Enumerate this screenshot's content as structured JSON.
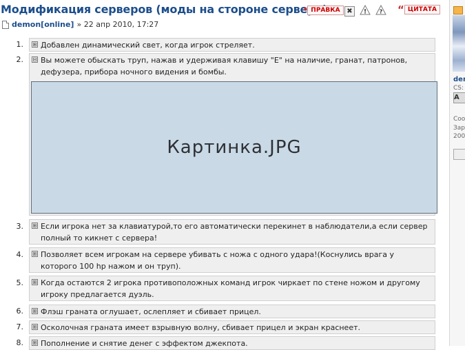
{
  "post": {
    "title": "Модификация серверов (моды на стороне сервера)",
    "edit_label": "ПРАВКА",
    "quote_label": "ЦИТАТА",
    "author": "demon[online]",
    "date": "» 22 апр 2010, 17:27",
    "delete_icon": "close-icon",
    "report_icon": "warning-icon",
    "help_icon": "question-icon"
  },
  "items": [
    {
      "num": "1.",
      "text": "Добавлен динамический свет, когда игрок стреляет.",
      "toggle": "⊞"
    },
    {
      "num": "2.",
      "text": "Вы можете обыскать труп, нажав и удерживая клавишу \"E\" на наличие, гранат, патронов, дефузера, прибора ночного видения и бомбы.",
      "toggle": "⊟",
      "image_label": "Картинка.JPG"
    },
    {
      "num": "3.",
      "text": "Если игрока нет за клавиатурой,то его автоматически перекинет в наблюдатели,а если сервер полный то кикнет с сервера!",
      "toggle": "⊞"
    },
    {
      "num": "4.",
      "text": "Позволяет всем игрокам на сервере убивать с ножа с одного удара!(Коснулись врага у которого 100 hp нажом и он труп).",
      "toggle": "⊞"
    },
    {
      "num": "5.",
      "text": "Когда остаются 2 игрока противоположных команд игрок чиркает по стене ножом и другому игроку предлагается дуэль.",
      "toggle": "⊞"
    },
    {
      "num": "6.",
      "text": "Флэш граната оглушает, ослепляет и сбивает прицел.",
      "toggle": "⊞"
    },
    {
      "num": "7.",
      "text": "Осколочная граната имеет взрывную волну, сбивает прицел и экран краснеет.",
      "toggle": "⊞"
    },
    {
      "num": "8.",
      "text": "Пополнение и снятие денег с эффектом джекпота.",
      "toggle": "⊞"
    }
  ],
  "sidebar": {
    "name": "der",
    "line1": "CS:",
    "btn": "A",
    "line2": "Соо",
    "line3": "Зар",
    "line4": "200"
  }
}
